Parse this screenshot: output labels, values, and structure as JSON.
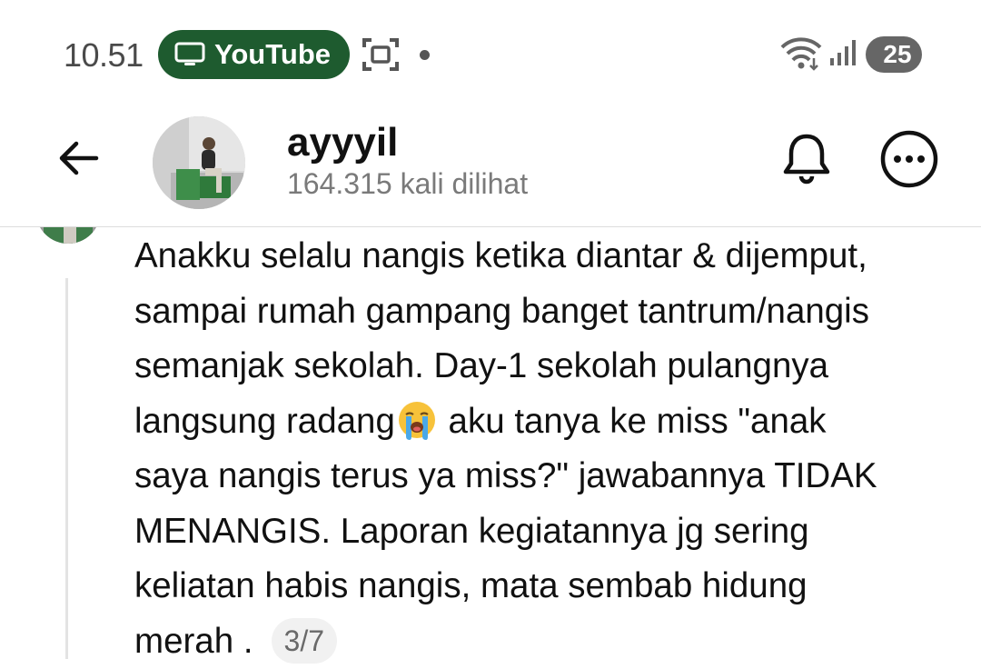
{
  "status_bar": {
    "time": "10.51",
    "app_pill_label": "YouTube",
    "battery_level": "25"
  },
  "header": {
    "username": "ayyyil",
    "views": "164.315 kali dilihat"
  },
  "comment": {
    "text_before_emoji": "Anakku selalu nangis ketika diantar & dijemput,\nsampai rumah gampang banget tantrum/nangis\nsemanjak sekolah. Day-1 sekolah pulangnya\nlangsung radang",
    "emoji": "loudly-crying-face",
    "text_after_emoji": " aku tanya ke miss \"anak\nsaya nangis terus ya miss?\" jawabannya TIDAK\nMENANGIS.  Laporan kegiatannya jg sering\nkeliatan habis nangis, mata sembab hidung\nmerah .",
    "page_indicator": "3/7"
  },
  "colors": {
    "pill_green": "#1e5b2f",
    "text": "#111111",
    "muted": "#7a7a7a"
  }
}
